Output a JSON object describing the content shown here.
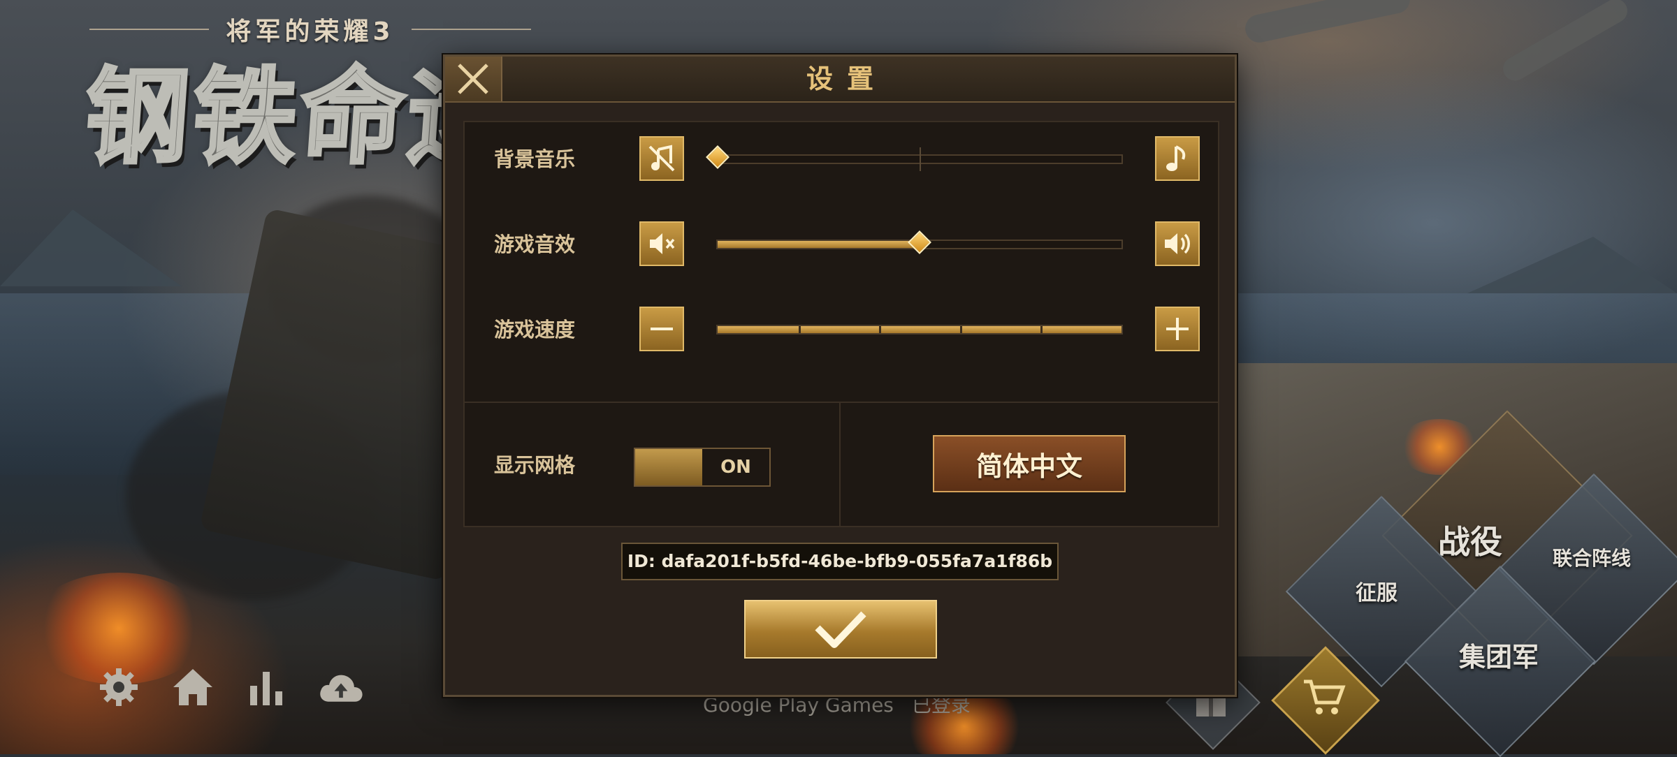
{
  "game": {
    "subtitle": "将军的荣耀3",
    "logo_text": "钢铁命运"
  },
  "dialog": {
    "title": "设置",
    "close_icon": "close-icon",
    "rows": {
      "music": {
        "label": "背景音乐",
        "level": 0.0,
        "left_icon": "music-off-icon",
        "right_icon": "music-note-icon"
      },
      "sfx": {
        "label": "游戏音效",
        "level": 0.5,
        "left_icon": "speaker-mute-icon",
        "right_icon": "speaker-on-icon"
      },
      "speed": {
        "label": "游戏速度",
        "level": 1.0,
        "steps": 5,
        "left_icon": "minus-icon",
        "right_icon": "plus-icon"
      }
    },
    "grid": {
      "label": "显示网格",
      "state": "ON"
    },
    "language_button": "简体中文",
    "id_text": "ID: dafa201f-b5fd-46be-bfb9-055fa7a1f86b",
    "confirm_icon": "checkmark-icon"
  },
  "bottom_bar": {
    "icons": [
      "settings-gear-icon",
      "home-icon",
      "stats-bars-icon",
      "cloud-upload-icon"
    ],
    "google_play": "Google Play Games",
    "login_status": "已登录"
  },
  "side_menu": {
    "campaign": "战役",
    "conquest": "征服",
    "alliance": "联合阵线",
    "army_group": "集团军"
  },
  "colors": {
    "accent_gold": "#c99b45",
    "dialog_bg": "#2a221c",
    "language_button": "#8a4f27"
  }
}
